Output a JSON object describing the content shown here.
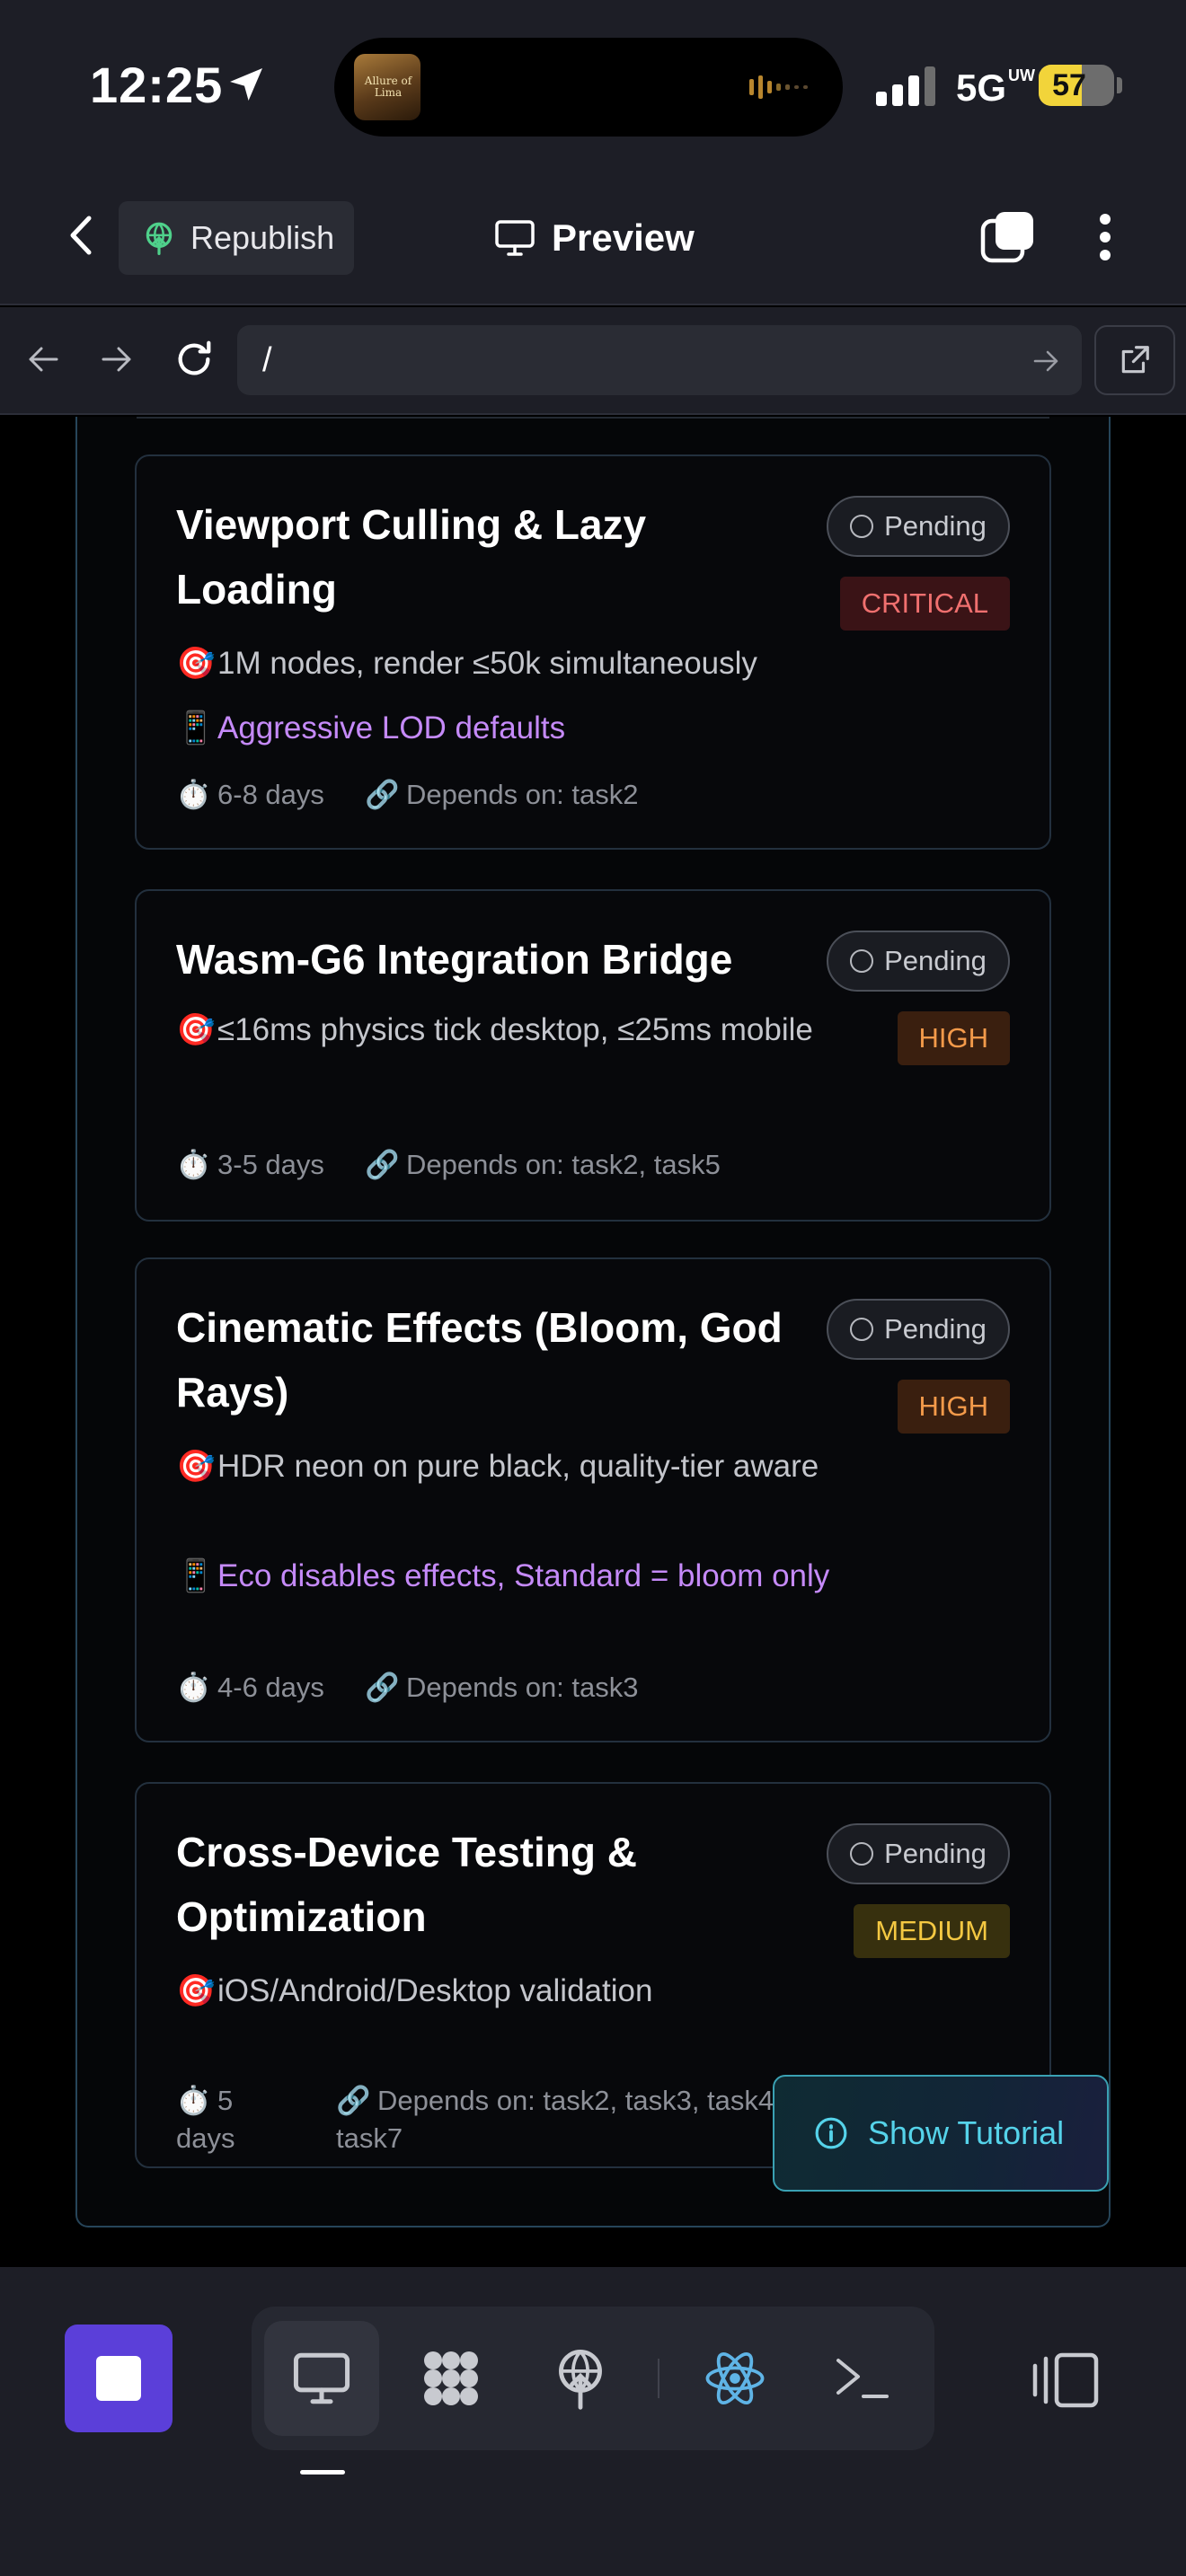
{
  "status_bar": {
    "time": "12:25",
    "network": "5G",
    "network_sup": "UW",
    "battery": "57",
    "battery_level": 0.57,
    "album_art_text": "Allure of Lima"
  },
  "header": {
    "republish_label": "Republish",
    "title": "Preview"
  },
  "browser": {
    "url": "/"
  },
  "tasks": [
    {
      "title": "Viewport Culling & Lazy Loading",
      "status": "Pending",
      "priority": "CRITICAL",
      "target": "1M nodes, render ≤50k simultaneously",
      "mobile": "Aggressive LOD defaults",
      "duration": "6-8 days",
      "depends": "Depends on: task2"
    },
    {
      "title": "Wasm-G6 Integration Bridge",
      "status": "Pending",
      "priority": "HIGH",
      "target": "≤16ms physics tick desktop, ≤25ms mobile",
      "duration": "3-5 days",
      "depends": "Depends on: task2, task5"
    },
    {
      "title": "Cinematic Effects (Bloom, God Rays)",
      "status": "Pending",
      "priority": "HIGH",
      "target": "HDR neon on pure black, quality-tier aware",
      "mobile": "Eco disables effects, Standard = bloom only",
      "duration": "4-6 days",
      "depends": "Depends on: task3"
    },
    {
      "title": "Cross-Device Testing & Optimization",
      "status": "Pending",
      "priority": "MEDIUM",
      "target": "iOS/Android/Desktop validation",
      "duration": "5 days",
      "depends": "Depends on: task2, task3, task4, task5, task6, task7"
    }
  ],
  "emoji": {
    "target": "🎯",
    "mobile": "📱",
    "timer": "⏱️",
    "link": "🔗"
  },
  "tutorial_label": "Show Tutorial",
  "colors": {
    "accent": "#5b3fd9",
    "critical": "#f0706f",
    "high": "#f39a4a",
    "medium": "#f4c842",
    "mobile_text": "#c58af9",
    "tutorial": "#55d3ea"
  },
  "toolbar": {
    "tools": [
      "monitor-icon",
      "plugins-icon",
      "deploy-icon",
      "react-icon",
      "terminal-icon"
    ]
  }
}
